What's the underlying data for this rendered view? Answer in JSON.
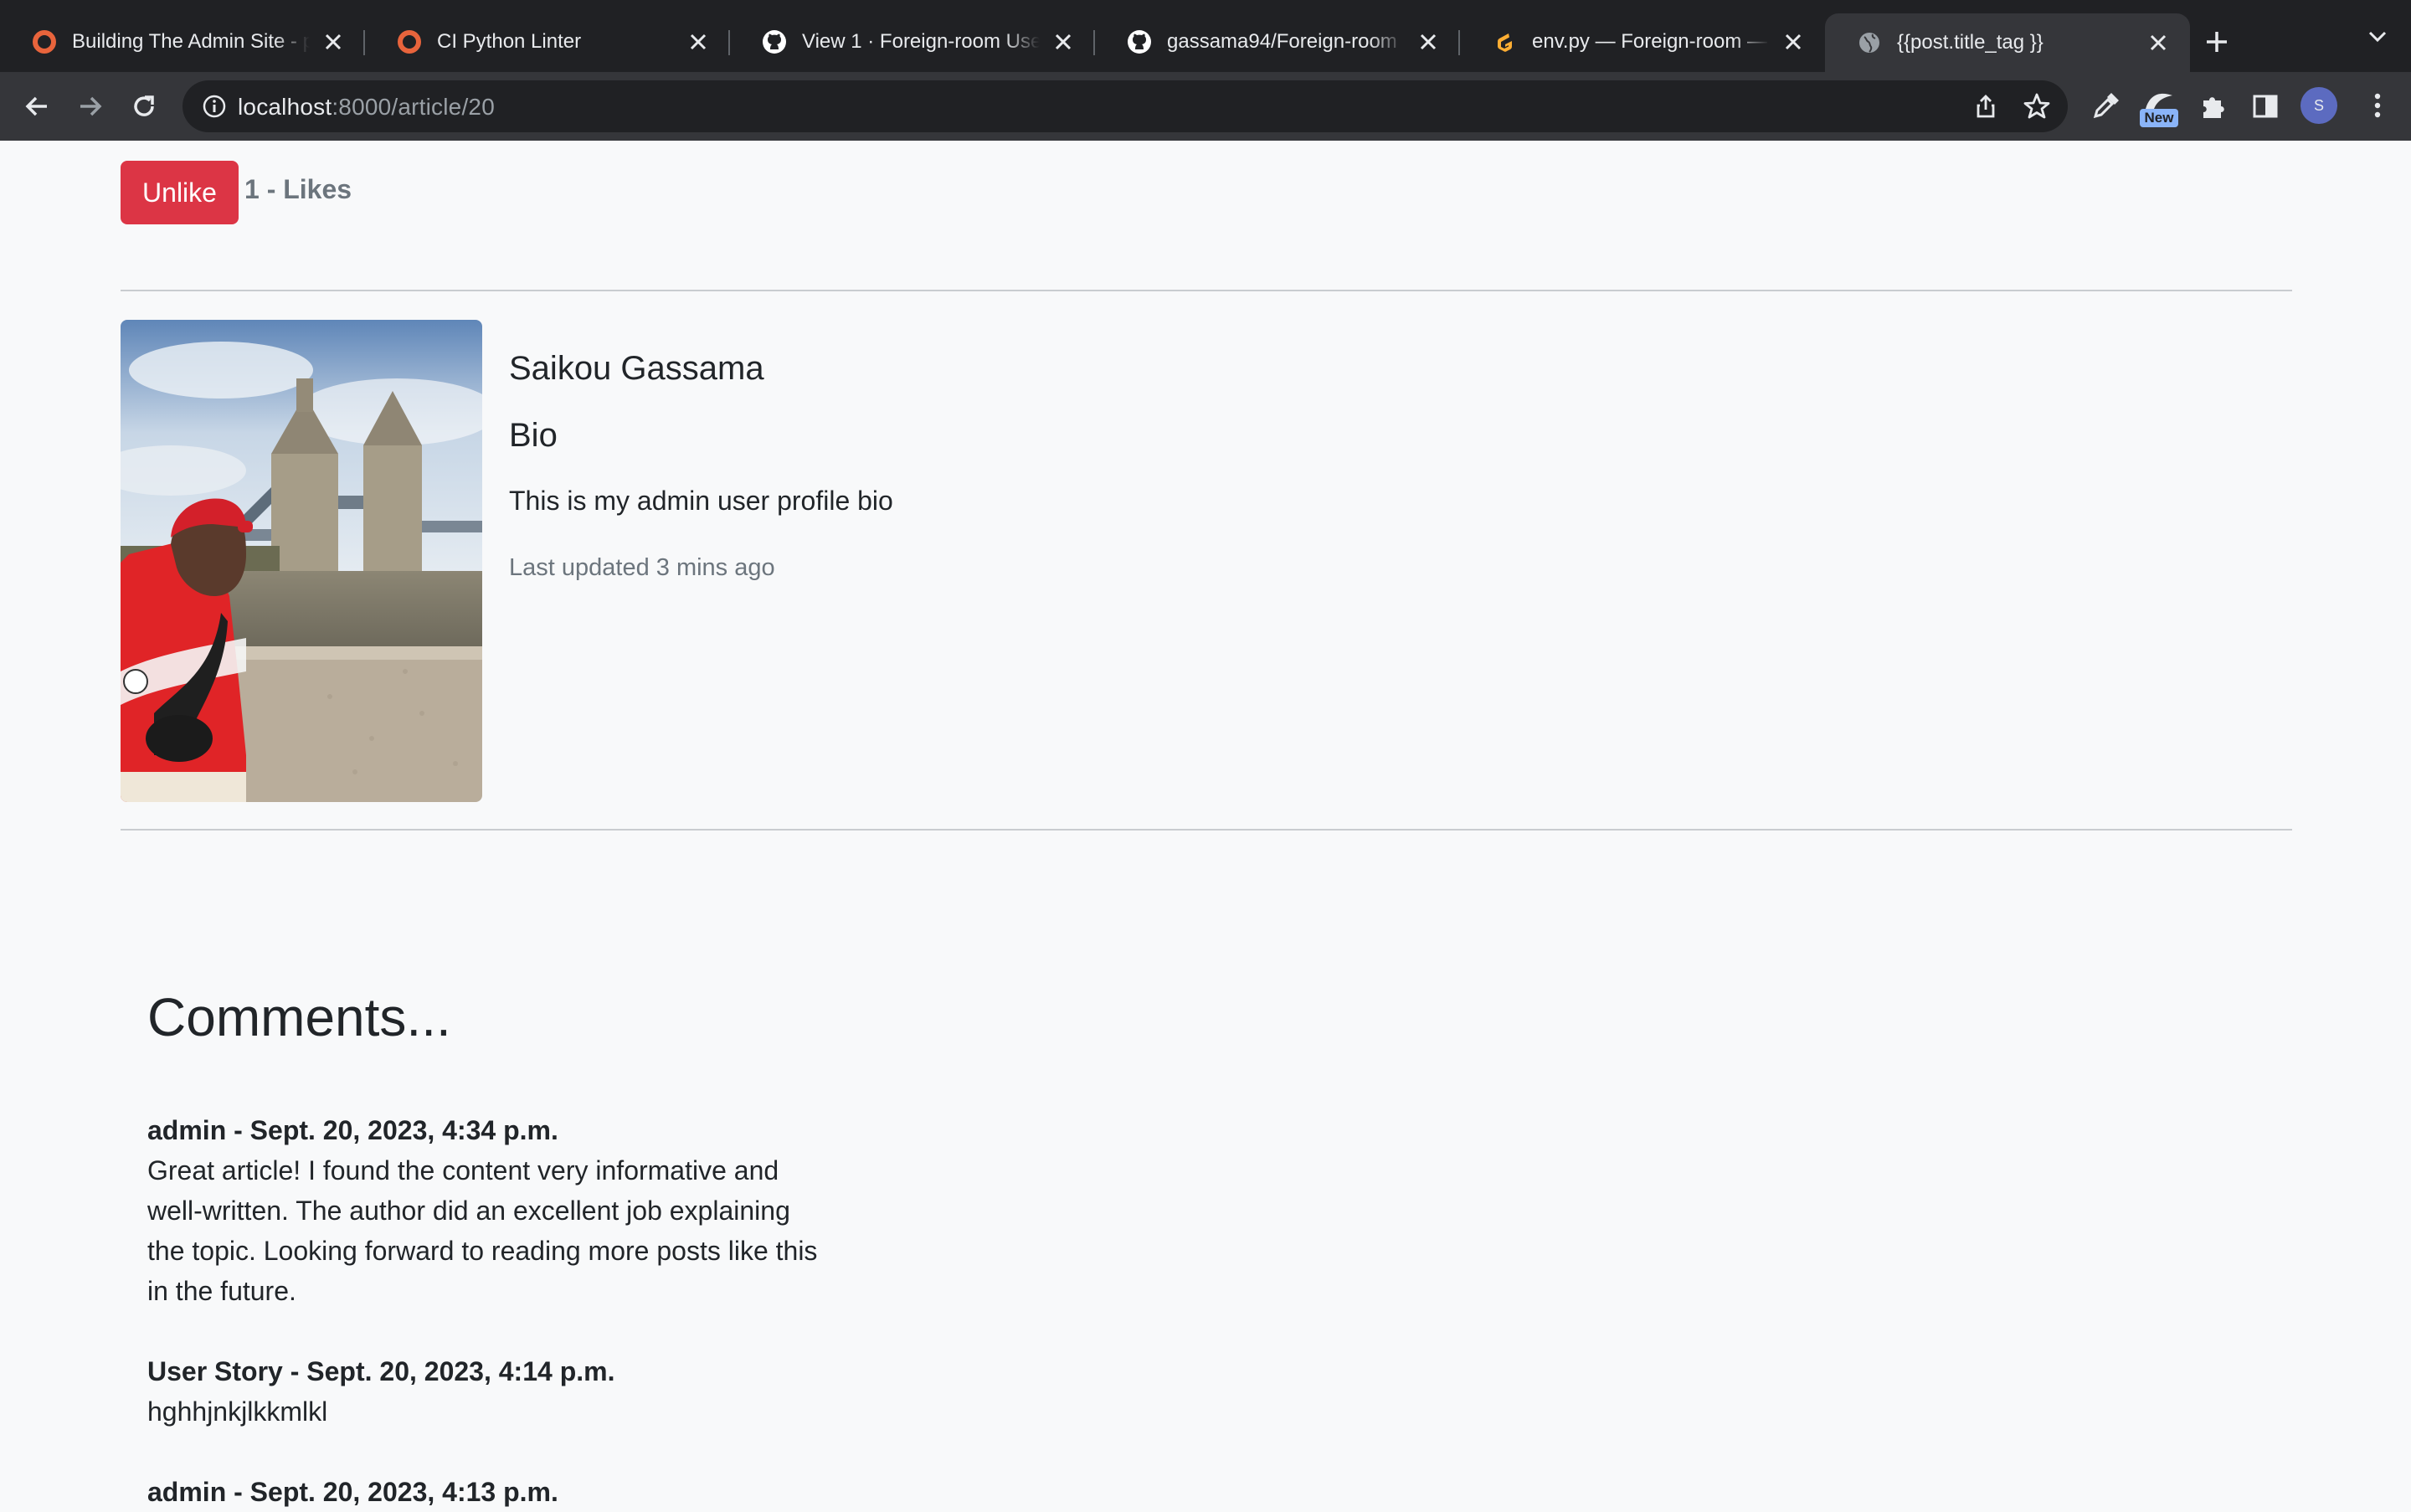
{
  "browser": {
    "tabs": [
      {
        "title": "Building The Admin Site - p",
        "icon": "circle-o-icon",
        "color": "#e8643c"
      },
      {
        "title": "CI Python Linter",
        "icon": "circle-o-icon",
        "color": "#e8643c"
      },
      {
        "title": "View 1 · Foreign-room User",
        "icon": "github-icon",
        "color": "#ffffff"
      },
      {
        "title": "gassama94/Foreign-room",
        "icon": "github-icon",
        "color": "#ffffff"
      },
      {
        "title": "env.py — Foreign-room — C",
        "icon": "gitpod-icon",
        "color": "#ffae33"
      },
      {
        "title": "{{post.title_tag }}",
        "icon": "globe-icon",
        "color": "#9aa0a6"
      }
    ],
    "active_tab_index": 5,
    "url_host": "localhost",
    "url_rest": ":8000/article/20",
    "extension_badge": "New",
    "avatar_letter": "S"
  },
  "post": {
    "like_button_label": "Unlike",
    "like_count_text": "1 - Likes",
    "accent": "#dc3545"
  },
  "author": {
    "name": "Saikou Gassama",
    "bio_heading": "Bio",
    "bio": "This is my admin user profile bio",
    "last_updated": "Last updated 3 mins ago"
  },
  "comments": {
    "title": "Comments...",
    "items": [
      {
        "meta": "admin - Sept. 20, 2023, 4:34 p.m.",
        "body": "Great article! I found the content very informative and well-written. The author did an excellent job explaining the topic. Looking forward to reading more posts like this in the future."
      },
      {
        "meta": "User Story - Sept. 20, 2023, 4:14 p.m.",
        "body": "hghhjnkjlkkmlkl"
      },
      {
        "meta": "admin - Sept. 20, 2023, 4:13 p.m.",
        "body": ""
      }
    ]
  }
}
